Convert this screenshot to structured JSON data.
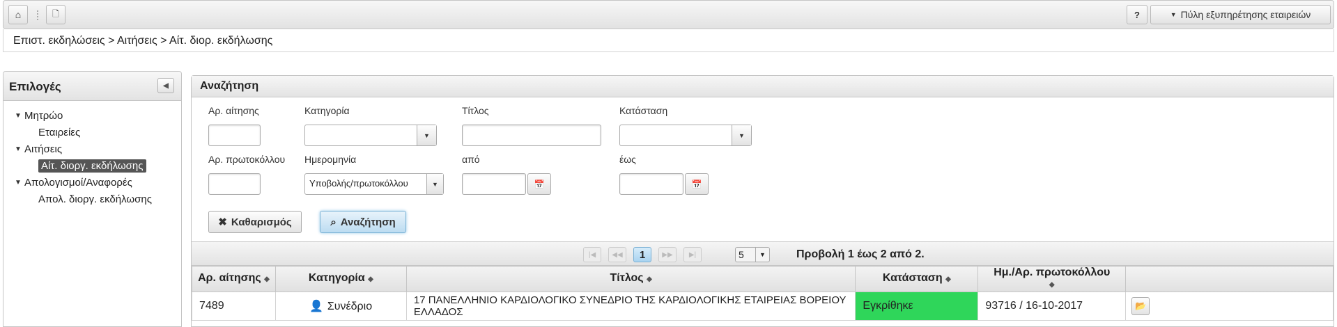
{
  "toolbar": {
    "home_icon": "⌂",
    "new_icon": "🗋",
    "help_label": "?",
    "portal_label": "Πύλη εξυπηρέτησης εταιρειών"
  },
  "breadcrumb": "Επιστ. εκδηλώσεις > Αιτήσεις > Αίτ. διορ. εκδήλωσης",
  "sidebar": {
    "title": "Επιλογές",
    "groups": [
      {
        "label": "Μητρώο",
        "items": [
          "Εταιρείες"
        ]
      },
      {
        "label": "Αιτήσεις",
        "items": [
          "Αίτ. διοργ. εκδήλωσης"
        ]
      },
      {
        "label": "Απολογισμοί/Αναφορές",
        "items": [
          "Απολ. διοργ. εκδήλωσης"
        ]
      }
    ],
    "selected": "Αίτ. διοργ. εκδήλωσης"
  },
  "search": {
    "title": "Αναζήτηση",
    "labels": {
      "app_no": "Αρ. αίτησης",
      "category": "Κατηγορία",
      "title": "Τίτλος",
      "status": "Κατάσταση",
      "protocol_no": "Αρ. πρωτοκόλλου",
      "date": "Ημερομηνία",
      "from": "από",
      "to": "έως"
    },
    "date_type_value": "Υποβολής/πρωτοκόλλου",
    "clear_label": "Καθαρισμός",
    "search_label": "Αναζήτηση"
  },
  "pager": {
    "current": "1",
    "rows_per_page": "5",
    "info": "Προβολή 1 έως 2 από 2."
  },
  "table": {
    "headers": [
      "Αρ. αίτησης",
      "Κατηγορία",
      "Τίτλος",
      "Κατάσταση",
      "Ημ./Αρ. πρωτοκόλλου"
    ],
    "rows": [
      {
        "app_no": "7489",
        "category": "Συνέδριο",
        "title": "17 ΠΑΝΕΛΛΗΝΙΟ ΚΑΡΔΙΟΛΟΓΙΚΟ ΣΥΝΕΔΡΙΟ ΤΗΣ ΚΑΡΔΙΟΛΟΓΙΚΗΣ ΕΤΑΙΡΕΙΑΣ ΒΟΡΕΙΟΥ ΕΛΛΑΔΟΣ",
        "status": "Εγκρίθηκε",
        "protocol": "93716 / 16-10-2017"
      }
    ]
  },
  "colors": {
    "approved": "#2fd65a",
    "accent": "#a9d3f0"
  }
}
